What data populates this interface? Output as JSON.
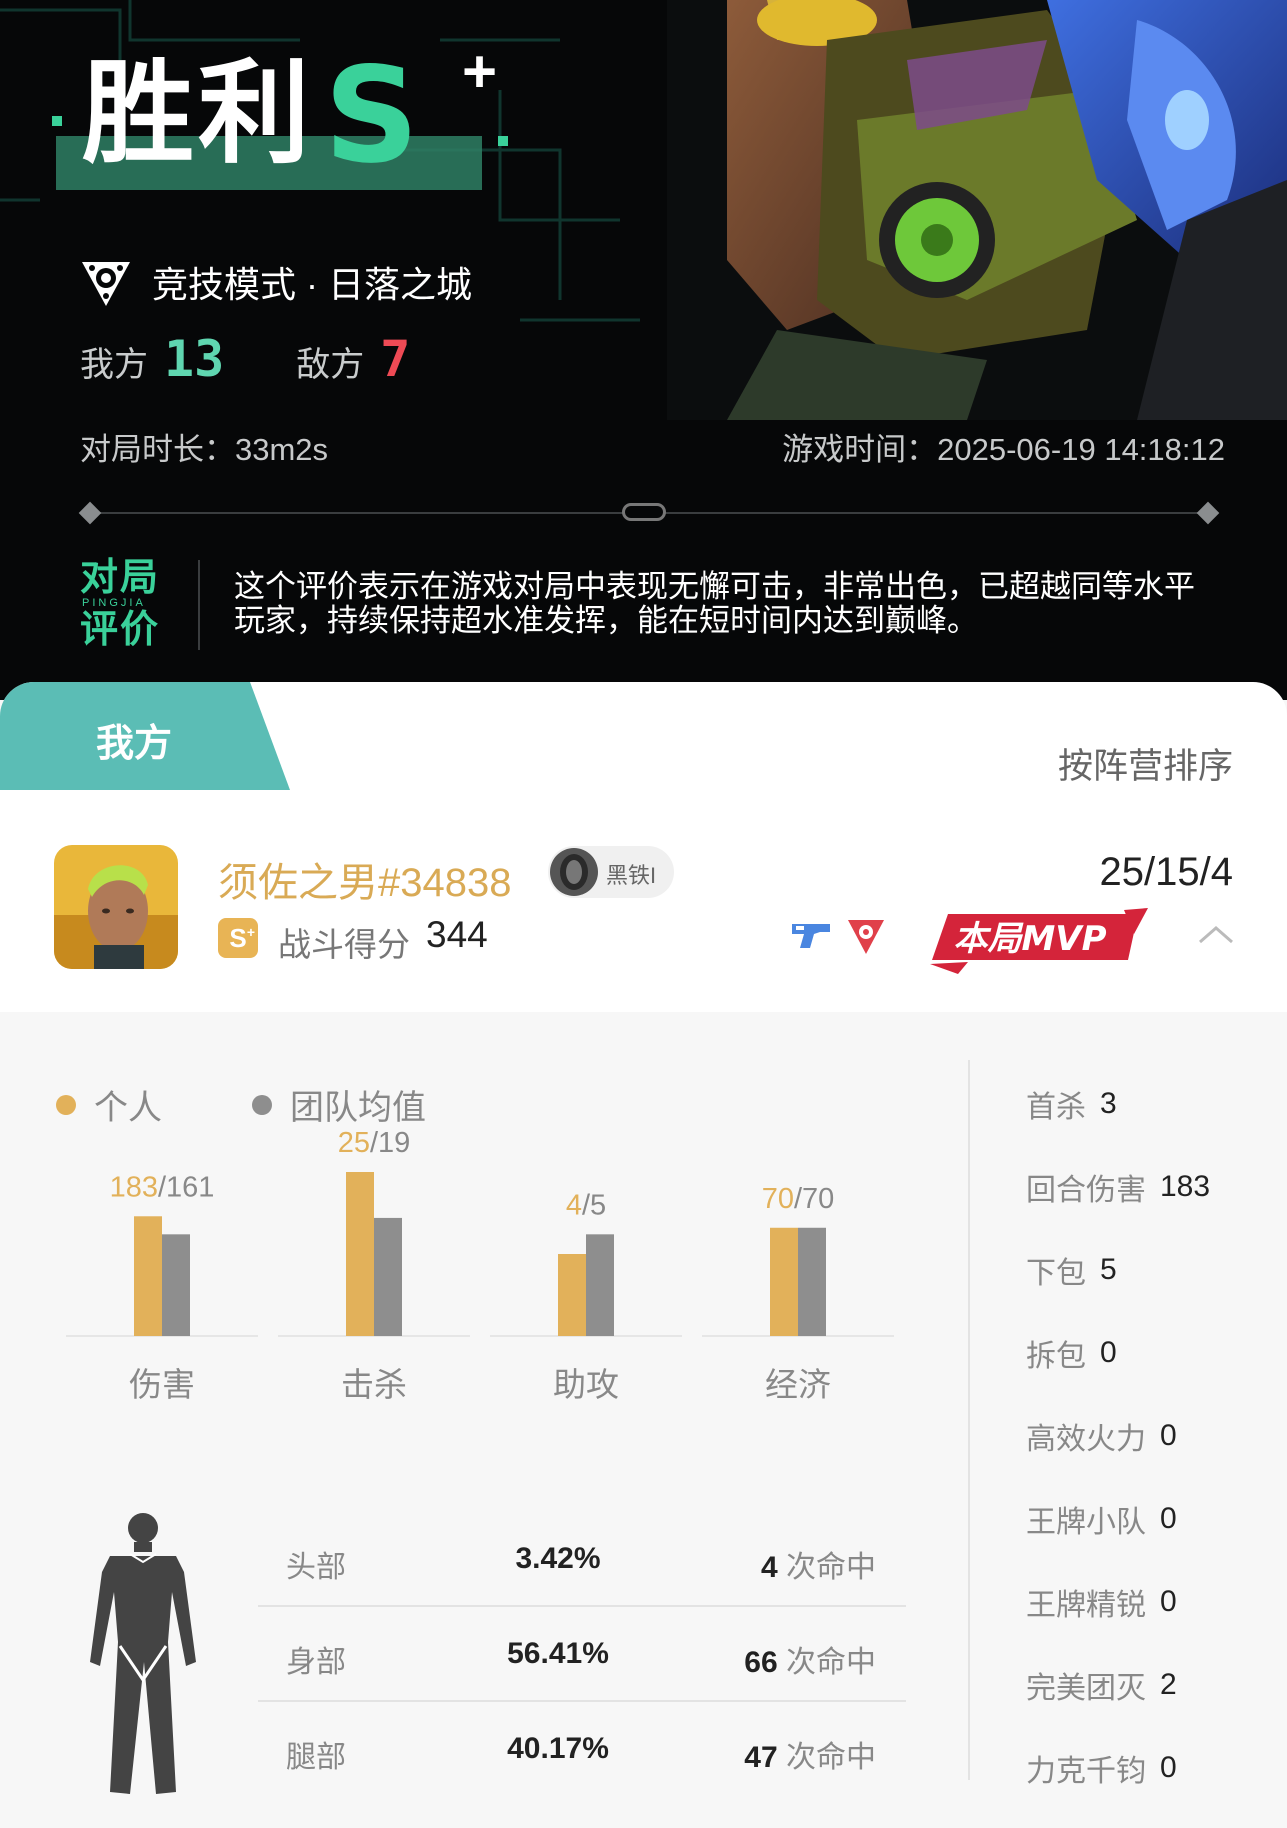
{
  "hero": {
    "result": "胜利",
    "grade": "S",
    "grade_plus": "+",
    "mode": "竞技模式 · 日落之城",
    "our_label": "我方",
    "our_score": "13",
    "enemy_label": "敌方",
    "enemy_score": "7",
    "duration": "对局时长：33m2s",
    "game_time": "游戏时间：2025-06-19 14:18:12",
    "eval_title_top": "对局",
    "eval_title_pinyin": "PINGJIA",
    "eval_title_bottom": "评价",
    "eval_text": "这个评价表示在游戏对局中表现无懈可击，非常出色，已超越同等水平玩家，持续保持超水准发挥，能在短时间内达到巅峰。"
  },
  "tabs": {
    "mine": "我方",
    "sort": "按阵营排序"
  },
  "player": {
    "name": "须佐之男#34838",
    "rank": "黑铁I",
    "s_badge": "S",
    "fight_label": "战斗得分",
    "fight_score": "344",
    "kda": "25/15/4",
    "mvp": "本局MVP"
  },
  "legend": {
    "personal": "个人",
    "team": "团队均值"
  },
  "colors": {
    "personal": "#e2b15a",
    "team": "#8e8e8e",
    "accent": "#3ad19a",
    "tab": "#5bbdb5",
    "mvp": "#d4243a"
  },
  "chart_data": {
    "type": "bar",
    "categories": [
      "伤害",
      "击杀",
      "助攻",
      "经济"
    ],
    "series": [
      {
        "name": "个人",
        "values": [
          183,
          25,
          4,
          70
        ]
      },
      {
        "name": "团队均值",
        "values": [
          161,
          19,
          5,
          70
        ]
      }
    ],
    "value_labels": [
      "183",
      "25",
      "4",
      "70"
    ],
    "avg_labels": [
      "161",
      "19",
      "5",
      "70"
    ],
    "personal_heights": [
      0.73,
      1.0,
      0.5,
      0.66
    ],
    "team_heights": [
      0.62,
      0.72,
      0.62,
      0.66
    ]
  },
  "side_stats": [
    {
      "label": "首杀",
      "value": "3"
    },
    {
      "label": "回合伤害",
      "value": "183"
    },
    {
      "label": "下包",
      "value": "5"
    },
    {
      "label": "拆包",
      "value": "0"
    },
    {
      "label": "高效火力",
      "value": "0"
    },
    {
      "label": "王牌小队",
      "value": "0"
    },
    {
      "label": "王牌精锐",
      "value": "0"
    },
    {
      "label": "完美团灭",
      "value": "2"
    },
    {
      "label": "力克千钧",
      "value": "0"
    }
  ],
  "hits": [
    {
      "part": "头部",
      "pct": "3.42%",
      "count": "4",
      "unit": "次命中"
    },
    {
      "part": "身部",
      "pct": "56.41%",
      "count": "66",
      "unit": "次命中"
    },
    {
      "part": "腿部",
      "pct": "40.17%",
      "count": "47",
      "unit": "次命中"
    }
  ]
}
